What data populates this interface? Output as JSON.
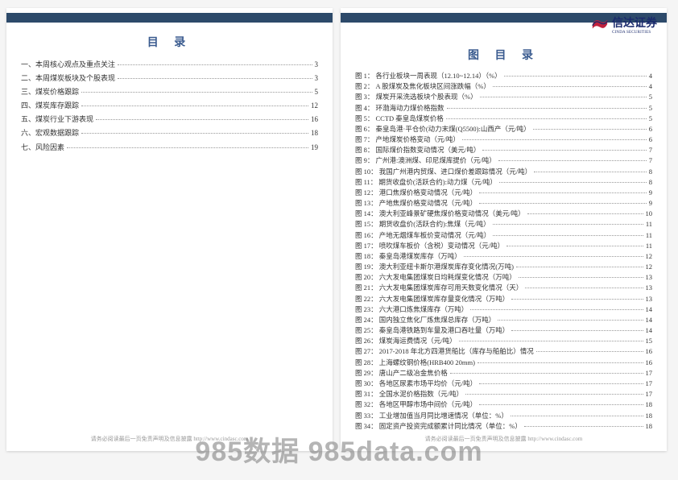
{
  "brand": {
    "name": "信达证券",
    "sub": "CINDA SECURITIES"
  },
  "left": {
    "title": "目 录",
    "items": [
      {
        "label": "一、本周核心观点及重点关注",
        "page": "3"
      },
      {
        "label": "二、本周煤炭板块及个股表现",
        "page": "3"
      },
      {
        "label": "三、煤炭价格跟踪",
        "page": "5"
      },
      {
        "label": "四、煤炭库存跟踪",
        "page": "12"
      },
      {
        "label": "五、煤炭行业下游表现",
        "page": "16"
      },
      {
        "label": "六、宏观数据跟踪",
        "page": "18"
      },
      {
        "label": "七、风险因素",
        "page": "19"
      }
    ]
  },
  "right": {
    "title": "图 目 录",
    "items": [
      {
        "label": "图 1： 各行业板块一周表现（12.10~12.14）（%）",
        "page": "4"
      },
      {
        "label": "图 2： A 股煤炭及焦化板块区间涨跌幅（%）",
        "page": "4"
      },
      {
        "label": "图 3： 煤炭开采洗选板块个股表现（%）",
        "page": "5"
      },
      {
        "label": "图 4： 环渤海动力煤价格指数",
        "page": "5"
      },
      {
        "label": "图 5： CCTD 秦皇岛煤炭价格",
        "page": "5"
      },
      {
        "label": "图 6： 秦皇岛港·平仓价(动力末煤(Q5500):山西产（元/吨）",
        "page": "6"
      },
      {
        "label": "图 7： 产地煤炭价格变动（元/吨）",
        "page": "6"
      },
      {
        "label": "图 8： 国际煤价指数变动情况（美元/吨）",
        "page": "7"
      },
      {
        "label": "图 9： 广州港:澳洲煤、印尼煤库提价（元/吨）",
        "page": "7"
      },
      {
        "label": "图 10： 我国广州港内贸煤、进口煤价差跟踪情况（元/吨）",
        "page": "8"
      },
      {
        "label": "图 11： 期货收盘价(活跃合约):动力煤（元/吨）",
        "page": "8"
      },
      {
        "label": "图 12： 港口焦煤价格变动情况（元/吨）",
        "page": "9"
      },
      {
        "label": "图 13： 产地焦煤价格变动情况（元/吨）",
        "page": "9"
      },
      {
        "label": "图 14： 澳大利亚峰景矿硬焦煤价格变动情况（美元/吨）",
        "page": "10"
      },
      {
        "label": "图 15： 期货收盘价(活跃合约):焦煤（元/吨）",
        "page": "11"
      },
      {
        "label": "图 16： 产地无烟煤车板价变动情况（元/吨）",
        "page": "11"
      },
      {
        "label": "图 17： 喷吹煤车板价（含税）变动情况（元/吨）",
        "page": "11"
      },
      {
        "label": "图 18： 秦皇岛港煤炭库存（万吨）",
        "page": "12"
      },
      {
        "label": "图 19： 澳大利亚纽卡斯尔港煤炭库存变化情况(万吨)",
        "page": "12"
      },
      {
        "label": "图 20： 六大发电集团煤炭日均耗煤变化情况（万吨）",
        "page": "13"
      },
      {
        "label": "图 21： 六大发电集团煤炭库存可用天数变化情况（天）",
        "page": "13"
      },
      {
        "label": "图 22： 六大发电集团煤炭库存量变化情况（万吨）",
        "page": "13"
      },
      {
        "label": "图 23： 六大港口炼焦煤库存（万吨）",
        "page": "14"
      },
      {
        "label": "图 24： 国内独立焦化厂炼焦煤总库存（万吨）",
        "page": "14"
      },
      {
        "label": "图 25： 秦皇岛港铁路到车量及港口吞吐量（万吨）",
        "page": "14"
      },
      {
        "label": "图 26： 煤炭海运费情况（元/吨）",
        "page": "15"
      },
      {
        "label": "图 27： 2017-2018 年北方四港货船比（库存与船舶比）情况",
        "page": "16"
      },
      {
        "label": "图 28： 上海螺纹钢价格(HRB400 20mm)",
        "page": "16"
      },
      {
        "label": "图 29： 唐山产二级冶金焦价格",
        "page": "17"
      },
      {
        "label": "图 30： 各地区尿素市场平均价（元/吨）",
        "page": "17"
      },
      {
        "label": "图 31： 全国水泥价格指数（元/吨）",
        "page": "17"
      },
      {
        "label": "图 32： 各地区甲醇市场中间价（元/吨）",
        "page": "18"
      },
      {
        "label": "图 33： 工业增加值当月同比增速情况（单位：%）",
        "page": "18"
      },
      {
        "label": "图 34： 固定资产投资完成额累计同比情况（单位：%）",
        "page": "18"
      }
    ]
  },
  "footer": "请务必阅读最后一页免责声明及信息披露 http://www.cindasc.com",
  "watermark": "985数据 985data.com"
}
